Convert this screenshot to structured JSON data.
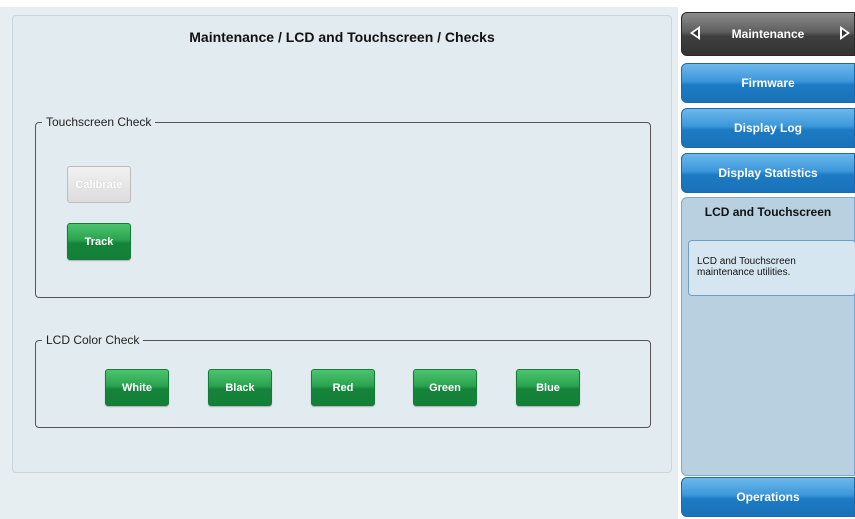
{
  "main": {
    "title": "Maintenance / LCD and Touchscreen / Checks",
    "touchscreen_group": {
      "legend": "Touchscreen Check",
      "calibrate_label": "Calibrate",
      "track_label": "Track"
    },
    "lcd_group": {
      "legend": "LCD Color Check",
      "buttons": [
        "White",
        "Black",
        "Red",
        "Green",
        "Blue"
      ]
    }
  },
  "sidebar": {
    "header": "Maintenance",
    "header_icons": [
      "triangle-left-icon",
      "triangle-right-icon"
    ],
    "items": [
      "Firmware",
      "Display Log",
      "Display Statistics"
    ],
    "active": {
      "title": "LCD and Touchscreen",
      "description": "LCD and Touchscreen maintenance utilities."
    },
    "bottom_item": "Operations"
  },
  "colors": {
    "button_green": "#2aa350",
    "nav_blue": "#3c97da",
    "header_gray": "#5e5e5e",
    "active_panel": "#b8d0e0"
  }
}
